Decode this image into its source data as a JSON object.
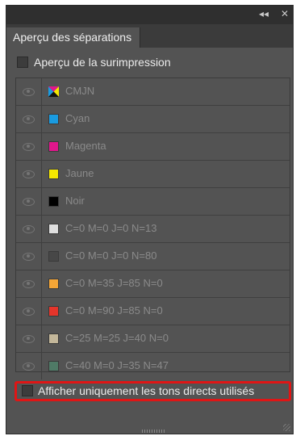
{
  "panel": {
    "tab_title": "Aperçu des séparations",
    "collapse_glyph": "◂◂",
    "close_glyph": "✕"
  },
  "overprint": {
    "label": "Aperçu de la surimpression",
    "checked": false
  },
  "separations": [
    {
      "name": "CMJN",
      "swatch": "cmyk-icon"
    },
    {
      "name": "Cyan",
      "color": "#1a9be0"
    },
    {
      "name": "Magenta",
      "color": "#e0178c"
    },
    {
      "name": "Jaune",
      "color": "#f5e800"
    },
    {
      "name": "Noir",
      "color": "#000000"
    },
    {
      "name": "C=0 M=0 J=0 N=13",
      "color": "#dedede"
    },
    {
      "name": "C=0 M=0 J=0 N=80",
      "color": "#474747"
    },
    {
      "name": "C=0 M=35 J=85 N=0",
      "color": "#f5a636"
    },
    {
      "name": "C=0 M=90 J=85 N=0",
      "color": "#e5352b"
    },
    {
      "name": "C=25 M=25 J=40 N=0",
      "color": "#c3b79a"
    },
    {
      "name": "C=40 M=0 J=35 N=47",
      "color": "#4f7a66"
    }
  ],
  "spot_only": {
    "label": "Afficher uniquement les tons directs utilisés",
    "checked": false
  }
}
